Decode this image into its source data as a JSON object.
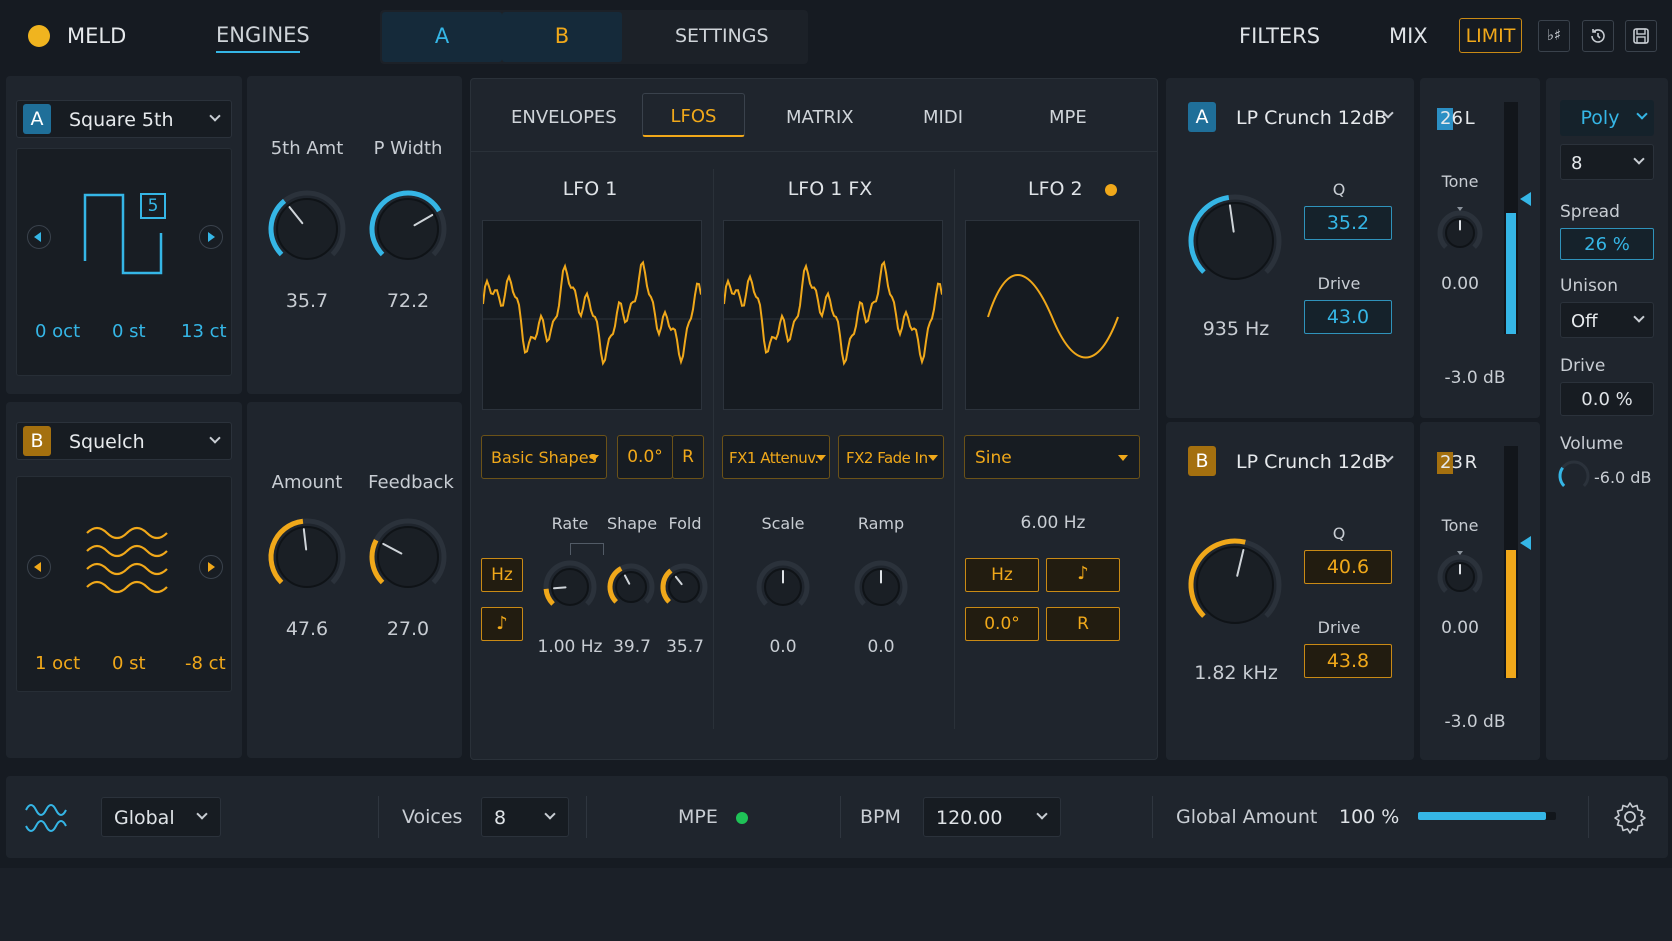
{
  "topbar": {
    "brand": "MELD",
    "engines": "ENGINES",
    "tab_a": "A",
    "tab_b": "B",
    "settings": "SETTINGS",
    "filters": "FILTERS",
    "mix": "MIX",
    "limit": "LIMIT",
    "flatsharp": "♭♯"
  },
  "osc_a": {
    "badge": "A",
    "name": "Square 5th",
    "shape_number": "5",
    "oct": "0 oct",
    "st": "0 st",
    "ct": "13 ct",
    "knob1_label": "5th Amt",
    "knob1_value": "35.7",
    "knob2_label": "P Width",
    "knob2_value": "72.2"
  },
  "osc_b": {
    "badge": "B",
    "name": "Squelch",
    "oct": "1 oct",
    "st": "0 st",
    "ct": "-8 ct",
    "knob1_label": "Amount",
    "knob1_value": "47.6",
    "knob2_label": "Feedback",
    "knob2_value": "27.0"
  },
  "mod_tabs": [
    "ENVELOPES",
    "LFOS",
    "MATRIX",
    "MIDI",
    "MPE"
  ],
  "lfo1": {
    "title": "LFO 1",
    "shape": "Basic Shapes",
    "phase": "0.0°",
    "retrig": "R",
    "hz": "Hz",
    "note": "♪",
    "rate_label": "Rate",
    "shape_label": "Shape",
    "fold_label": "Fold",
    "rate": "1.00 Hz",
    "shape_val": "39.7",
    "fold": "35.7"
  },
  "lfo1fx": {
    "title": "LFO 1 FX",
    "fx1": "FX1 Attenuv.",
    "fx2": "FX2 Fade In",
    "scale_label": "Scale",
    "ramp_label": "Ramp",
    "scale": "0.0",
    "ramp": "0.0"
  },
  "lfo2": {
    "title": "LFO 2",
    "shape": "Sine",
    "rate": "6.00 Hz",
    "hz": "Hz",
    "note": "♪",
    "phase": "0.0°",
    "retrig": "R"
  },
  "filter_a": {
    "badge": "A",
    "type": "LP Crunch 12dB",
    "freq": "935 Hz",
    "q_label": "Q",
    "q": "35.2",
    "drive_label": "Drive",
    "drive": "43.0",
    "chan": "26 L",
    "tone_label": "Tone",
    "tone": "0.00",
    "level": "-3.0 dB"
  },
  "filter_b": {
    "badge": "B",
    "type": "LP Crunch 12dB",
    "freq": "1.82 kHz",
    "q_label": "Q",
    "q": "40.6",
    "drive_label": "Drive",
    "drive": "43.8",
    "chan": "23 R",
    "tone_label": "Tone",
    "tone": "0.00",
    "level": "-3.0 dB"
  },
  "voice": {
    "mode": "Poly",
    "count": "8",
    "spread_label": "Spread",
    "spread": "26 %",
    "unison_label": "Unison",
    "unison": "Off",
    "drive_label": "Drive",
    "drive": "0.0 %",
    "volume_label": "Volume",
    "volume": "-6.0 dB"
  },
  "bottombar": {
    "scope": "Global",
    "voices_label": "Voices",
    "voices": "8",
    "mpe_label": "MPE",
    "bpm_label": "BPM",
    "bpm": "120.00",
    "global_amount_label": "Global Amount",
    "global_amount": "100 %",
    "global_amount_fraction": 1.0
  },
  "colors": {
    "cyan": "#35b6e6",
    "amber": "#f0a81a",
    "panel": "#1f252d",
    "bg": "#161b22"
  },
  "icons": [
    "logo-dot-icon",
    "chevron-down-icon",
    "arrow-left-icon",
    "arrow-right-icon",
    "square-wave-icon",
    "squelch-wave-icon",
    "note-icon",
    "history-icon",
    "save-icon",
    "wave-logo-icon",
    "gear-icon"
  ]
}
